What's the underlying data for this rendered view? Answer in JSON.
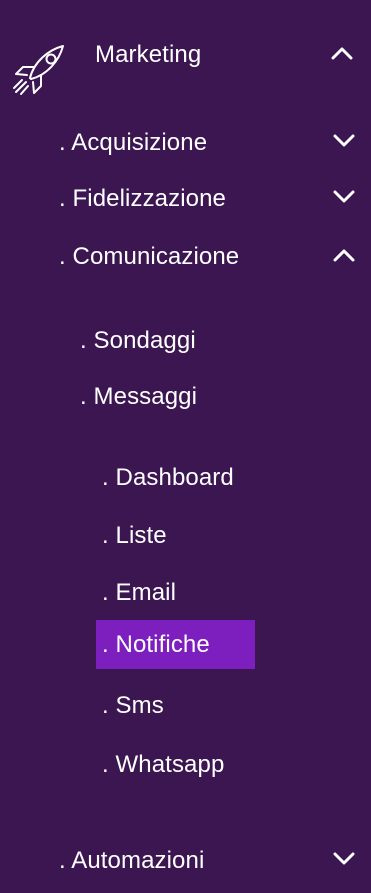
{
  "menu": {
    "section": {
      "label": "Marketing",
      "icon": "rocket-icon",
      "state": "expanded"
    },
    "items": [
      {
        "label": ". Acquisizione",
        "state": "collapsed"
      },
      {
        "label": ". Fidelizzazione",
        "state": "collapsed"
      },
      {
        "label": ". Comunicazione",
        "state": "expanded"
      }
    ],
    "comunicazione_children": [
      {
        "label": ". Sondaggi"
      },
      {
        "label": ". Messaggi"
      }
    ],
    "messaggi_children": [
      {
        "label": ". Dashboard"
      },
      {
        "label": ". Liste"
      },
      {
        "label": ". Email"
      },
      {
        "label": ". Notifiche",
        "active": true
      },
      {
        "label": ". Sms"
      },
      {
        "label": ". Whatsapp"
      }
    ],
    "bottom_item": {
      "label": ". Automazioni",
      "state": "collapsed"
    }
  },
  "colors": {
    "background": "#3b1650",
    "active": "#7d1fbf",
    "text": "#ffffff"
  }
}
